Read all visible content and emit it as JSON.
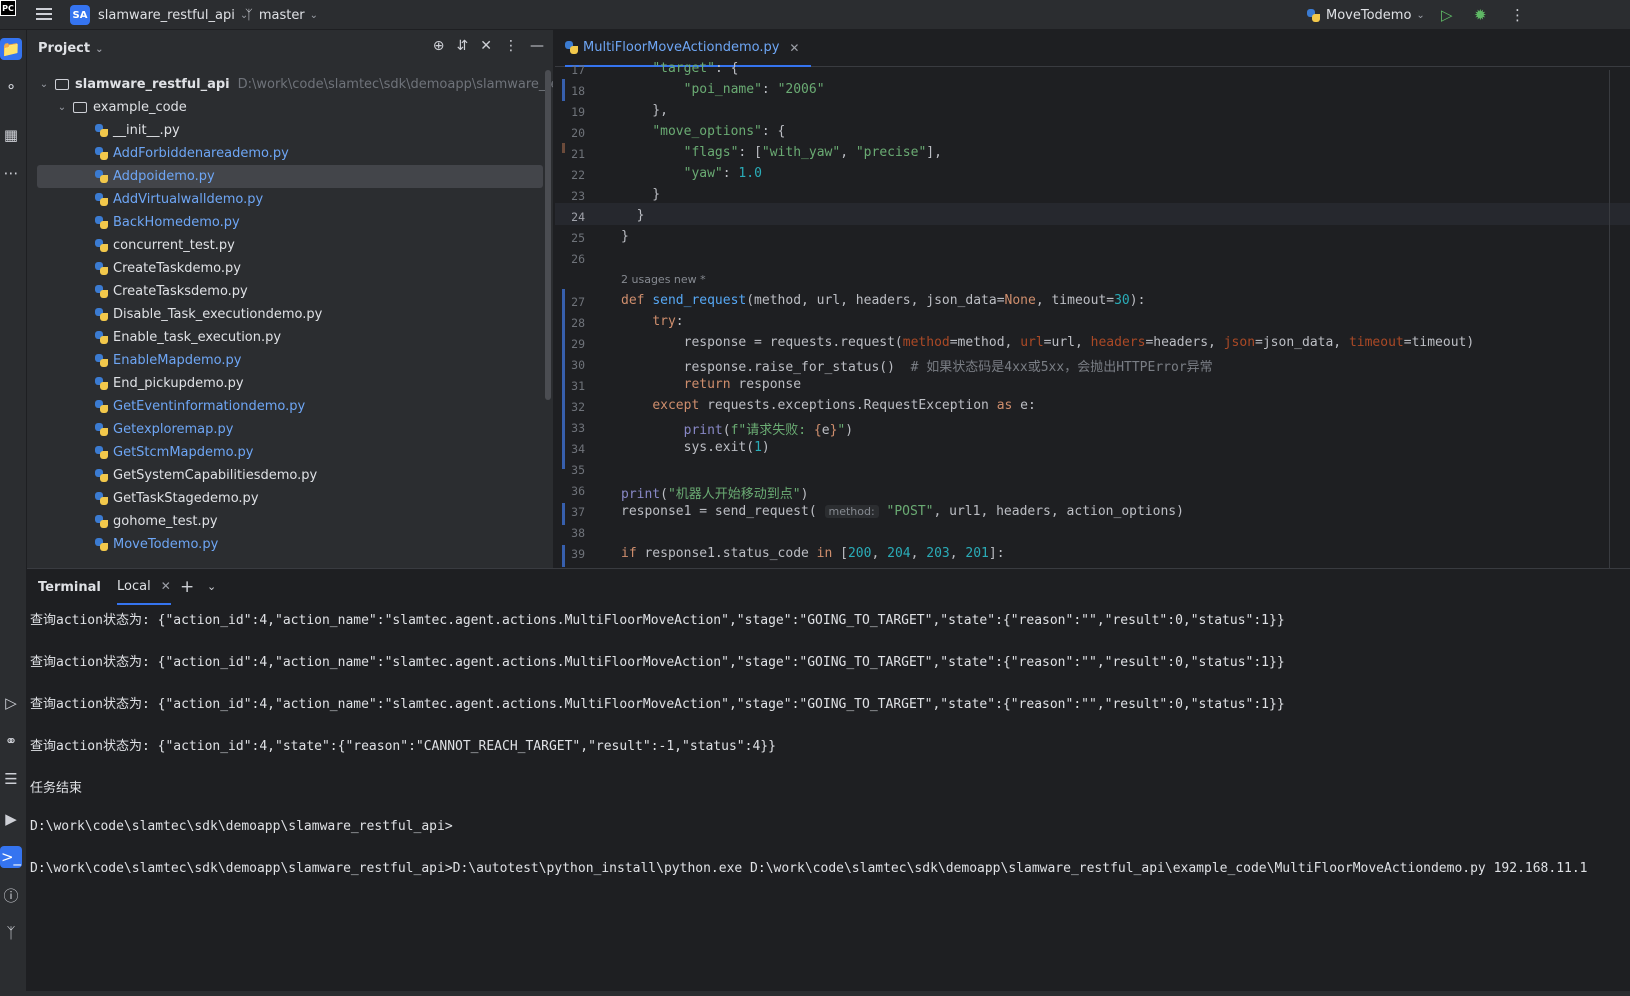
{
  "app": {
    "logo": "PC",
    "project_badge": "SA",
    "project_name": "slamware_restful_api",
    "branch": "master",
    "run_config": "MoveTodemo"
  },
  "project_panel": {
    "title": "Project",
    "root": {
      "name": "slamware_restful_api",
      "path": "D:\\work\\code\\slamtec\\sdk\\demoapp\\slamware_restful_api"
    },
    "folder": "example_code",
    "files": [
      {
        "name": "__init__.py",
        "modified": false
      },
      {
        "name": "AddForbiddenareademo.py",
        "modified": true
      },
      {
        "name": "Addpoidemo.py",
        "modified": true,
        "selected": true
      },
      {
        "name": "AddVirtualwalldemo.py",
        "modified": true
      },
      {
        "name": "BackHomedemo.py",
        "modified": true
      },
      {
        "name": "concurrent_test.py",
        "modified": false
      },
      {
        "name": "CreateTaskdemo.py",
        "modified": false
      },
      {
        "name": "CreateTasksdemo.py",
        "modified": false
      },
      {
        "name": "Disable_Task_executiondemo.py",
        "modified": false
      },
      {
        "name": "Enable_task_execution.py",
        "modified": false
      },
      {
        "name": "EnableMapdemo.py",
        "modified": true
      },
      {
        "name": "End_pickupdemo.py",
        "modified": false
      },
      {
        "name": "GetEventinformationdemo.py",
        "modified": true
      },
      {
        "name": "Getexploremap.py",
        "modified": true
      },
      {
        "name": "GetStcmMapdemo.py",
        "modified": true
      },
      {
        "name": "GetSystemCapabilitiesdemo.py",
        "modified": false
      },
      {
        "name": "GetTaskStagedemo.py",
        "modified": false
      },
      {
        "name": "gohome_test.py",
        "modified": false
      },
      {
        "name": "MoveTodemo.py",
        "modified": true
      }
    ]
  },
  "editor": {
    "tab_name": "MultiFloorMoveActiondemo.py",
    "usages_hint": "2 usages   new *",
    "param_hint": "method:",
    "line_numbers": [
      "17",
      "18",
      "19",
      "20",
      "21",
      "22",
      "23",
      "24",
      "25",
      "26",
      "27",
      "28",
      "29",
      "30",
      "31",
      "32",
      "33",
      "34",
      "35",
      "36",
      "37",
      "38",
      "39"
    ],
    "current_line": "24"
  },
  "terminal": {
    "title": "Terminal",
    "tab": "Local",
    "lines": [
      "查询action状态为: {\"action_id\":4,\"action_name\":\"slamtec.agent.actions.MultiFloorMoveAction\",\"stage\":\"GOING_TO_TARGET\",\"state\":{\"reason\":\"\",\"result\":0,\"status\":1}}",
      "查询action状态为: {\"action_id\":4,\"action_name\":\"slamtec.agent.actions.MultiFloorMoveAction\",\"stage\":\"GOING_TO_TARGET\",\"state\":{\"reason\":\"\",\"result\":0,\"status\":1}}",
      "查询action状态为: {\"action_id\":4,\"action_name\":\"slamtec.agent.actions.MultiFloorMoveAction\",\"stage\":\"GOING_TO_TARGET\",\"state\":{\"reason\":\"\",\"result\":0,\"status\":1}}",
      "查询action状态为: {\"action_id\":4,\"state\":{\"reason\":\"CANNOT_REACH_TARGET\",\"result\":-1,\"status\":4}}",
      "任务结束",
      "D:\\work\\code\\slamtec\\sdk\\demoapp\\slamware_restful_api>",
      "D:\\work\\code\\slamtec\\sdk\\demoapp\\slamware_restful_api>D:\\autotest\\python_install\\python.exe D:\\work\\code\\slamtec\\sdk\\demoapp\\slamware_restful_api\\example_code\\MultiFloorMoveActiondemo.py 192.168.11.1"
    ]
  },
  "colors": {
    "accent": "#3574f0",
    "modified_file": "#6ea6f5",
    "keyword": "#cf8e6d",
    "string": "#6aab73",
    "number": "#2aacb8"
  }
}
